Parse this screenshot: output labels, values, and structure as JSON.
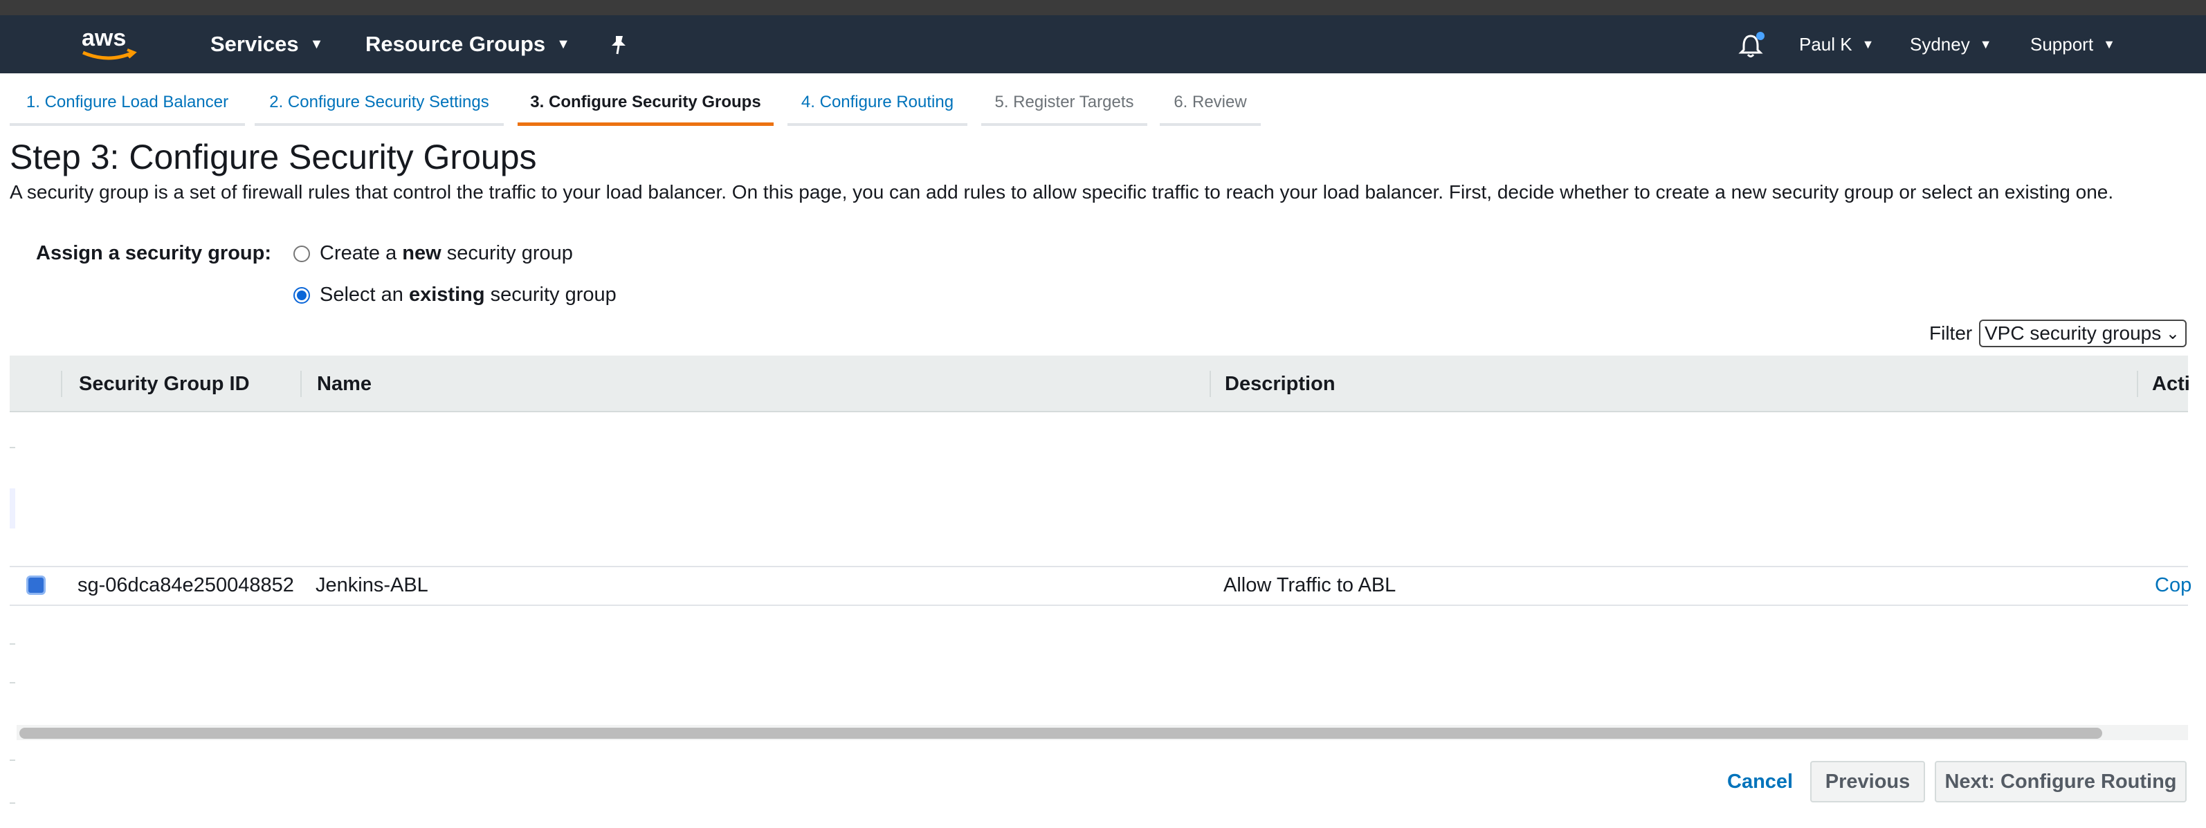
{
  "topnav": {
    "logo_text": "aws",
    "services_label": "Services",
    "resource_groups_label": "Resource Groups",
    "pin_icon": "pin-icon",
    "bell_icon": "bell-icon",
    "user_label": "Paul K",
    "region_label": "Sydney",
    "support_label": "Support",
    "colors": {
      "bar": "#232f3e",
      "accent": "#ff9900"
    }
  },
  "wizard_tabs": [
    {
      "label": "1. Configure Load Balancer",
      "state": "link"
    },
    {
      "label": "2. Configure Security Settings",
      "state": "link"
    },
    {
      "label": "3. Configure Security Groups",
      "state": "active"
    },
    {
      "label": "4. Configure Routing",
      "state": "link"
    },
    {
      "label": "5. Register Targets",
      "state": "disabled"
    },
    {
      "label": "6. Review",
      "state": "disabled"
    }
  ],
  "page": {
    "title": "Step 3: Configure Security Groups",
    "description": "A security group is a set of firewall rules that control the traffic to your load balancer. On this page, you can add rules to allow specific traffic to reach your load balancer. First, decide whether to create a new security group or select an existing one."
  },
  "assign": {
    "label": "Assign a security group:",
    "options": [
      {
        "prefix": "Create a ",
        "bold": "new",
        "suffix": " security group",
        "checked": false
      },
      {
        "prefix": "Select an ",
        "bold": "existing",
        "suffix": " security group",
        "checked": true
      }
    ]
  },
  "filter": {
    "label": "Filter",
    "selected": "VPC security groups"
  },
  "table": {
    "columns": [
      "Security Group ID",
      "Name",
      "Description",
      "Acti"
    ],
    "rows": [
      {
        "id": "sg-06dca84e250048852",
        "name": "Jenkins-ABL",
        "description": "Allow Traffic to ABL",
        "action": "Cop",
        "checked": true
      }
    ]
  },
  "footer": {
    "cancel_label": "Cancel",
    "previous_label": "Previous",
    "next_label": "Next: Configure Routing"
  }
}
